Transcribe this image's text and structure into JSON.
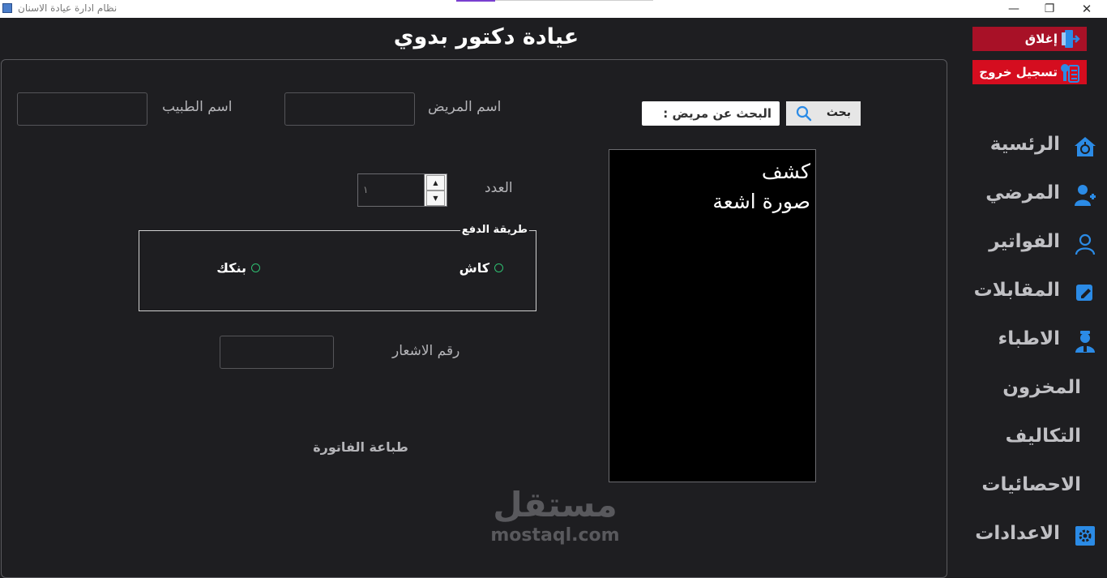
{
  "window": {
    "title": "نظام ادارة عيادة الاسنان",
    "minimize": "—",
    "maximize": "❐",
    "close": "✕"
  },
  "header": {
    "title": "عيادة دكتور بدوي"
  },
  "form": {
    "doctor_label": "اسم الطبيب",
    "doctor_value": "",
    "patient_label": "اسم المريض",
    "patient_value": "",
    "count_label": "العدد",
    "count_value": "١",
    "payment_group_label": "طريقة الدفع",
    "payment_options": [
      "كاش",
      "بنكك"
    ],
    "notification_label": "رقم الاشعار",
    "notification_value": "",
    "print_label": "طباعة الفاتورة"
  },
  "search": {
    "placeholder": "البحث عن مريض :",
    "button_label": "بحث"
  },
  "services_list": [
    "كشف",
    "صورة اشعة"
  ],
  "sidebar": {
    "close_label": "إغلاق",
    "logout_label": "تسجيل خروج",
    "items": [
      {
        "label": "الرئسية",
        "icon": "home-medical-icon"
      },
      {
        "label": "المرضي",
        "icon": "patient-icon"
      },
      {
        "label": "الفواتير",
        "icon": "user-icon"
      },
      {
        "label": "المقابلات",
        "icon": "edit-icon"
      },
      {
        "label": "الاطباء",
        "icon": "doctor-icon"
      },
      {
        "label": "المخزون",
        "icon": ""
      },
      {
        "label": "التكاليف",
        "icon": ""
      },
      {
        "label": "الاحصائيات",
        "icon": ""
      },
      {
        "label": "الاعدادات",
        "icon": "gear-icon"
      }
    ]
  },
  "watermark": {
    "arabic": "مستقل",
    "latin": "mostaql.com"
  },
  "colors": {
    "background": "#1e1e21",
    "accent_blue": "#2b8be6",
    "close_red": "#a81127",
    "logout_red": "#d50d1f",
    "radio_green": "#2fbf71"
  }
}
